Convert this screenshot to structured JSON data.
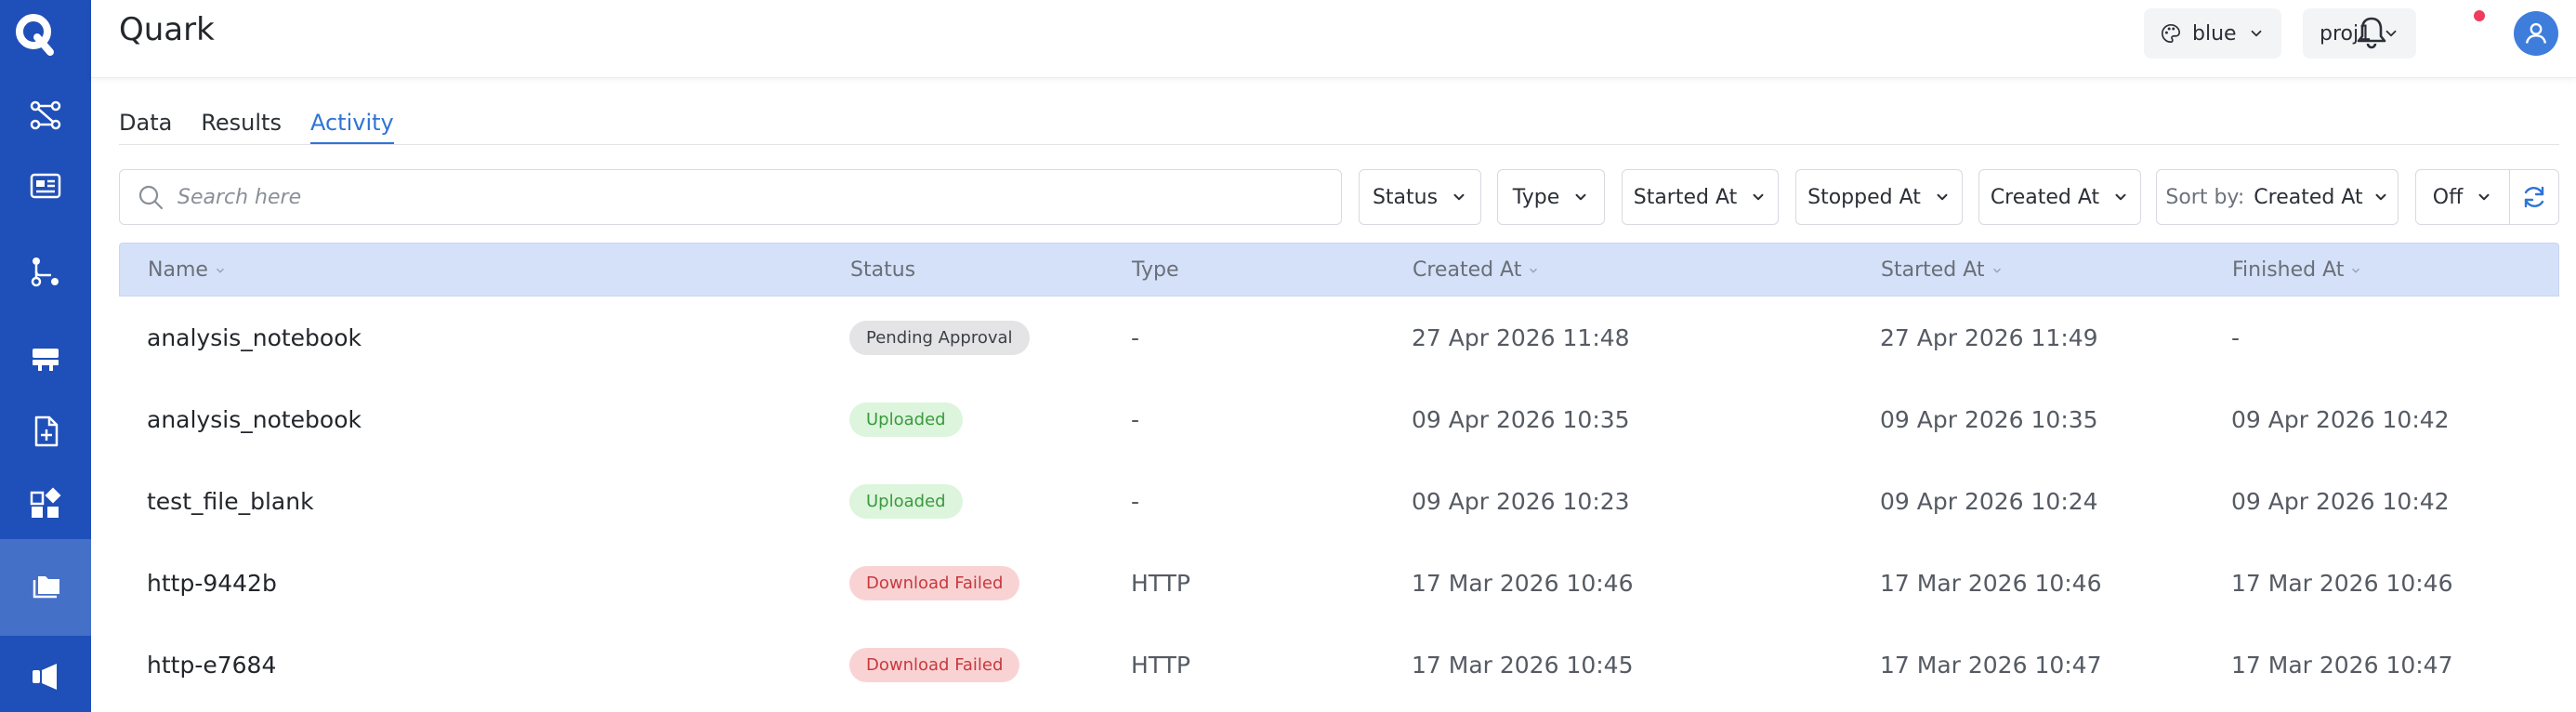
{
  "app": {
    "title": "Quark"
  },
  "header": {
    "theme_label": "blue",
    "project_label": "proj1"
  },
  "tabs": [
    {
      "label": "Data"
    },
    {
      "label": "Results"
    },
    {
      "label": "Activity"
    }
  ],
  "active_tab": "Activity",
  "search": {
    "placeholder": "Search here",
    "value": ""
  },
  "filters": {
    "status": "Status",
    "type": "Type",
    "started_at": "Started At",
    "stopped_at": "Stopped At",
    "created_at": "Created At",
    "sort_by_label": "Sort by:",
    "sort_by_value": "Created At",
    "auto_refresh": "Off"
  },
  "table": {
    "columns": [
      "Name",
      "Status",
      "Type",
      "Created At",
      "Started At",
      "Finished At"
    ],
    "rows": [
      {
        "name": "analysis_notebook",
        "status": "Pending Approval",
        "status_kind": "pending",
        "type": "-",
        "created": "27 Apr 2026 11:48",
        "started": "27 Apr 2026 11:49",
        "finished": "-"
      },
      {
        "name": "analysis_notebook",
        "status": "Uploaded",
        "status_kind": "uploaded",
        "type": "-",
        "created": "09 Apr 2026 10:35",
        "started": "09 Apr 2026 10:35",
        "finished": "09 Apr 2026 10:42"
      },
      {
        "name": "test_file_blank",
        "status": "Uploaded",
        "status_kind": "uploaded",
        "type": "-",
        "created": "09 Apr 2026 10:23",
        "started": "09 Apr 2026 10:24",
        "finished": "09 Apr 2026 10:42"
      },
      {
        "name": "http-9442b",
        "status": "Download Failed",
        "status_kind": "failed",
        "type": "HTTP",
        "created": "17 Mar 2026 10:46",
        "started": "17 Mar 2026 10:46",
        "finished": "17 Mar 2026 10:46"
      },
      {
        "name": "http-e7684",
        "status": "Download Failed",
        "status_kind": "failed",
        "type": "HTTP",
        "created": "17 Mar 2026 10:45",
        "started": "17 Mar 2026 10:47",
        "finished": "17 Mar 2026 10:47"
      }
    ]
  },
  "colors": {
    "sidebar": "#1f4fb8",
    "sidebar_active": "#4570c8",
    "accent": "#2f74d6",
    "table_header": "#d4e1f8",
    "notification_dot": "#ef3b5d"
  },
  "icons": {
    "sidebar": [
      "pipeline-icon",
      "dashboard-icon",
      "workflow-icon",
      "server-icon",
      "file-add-icon",
      "widgets-icon",
      "folder-icon",
      "megaphone-icon"
    ]
  }
}
